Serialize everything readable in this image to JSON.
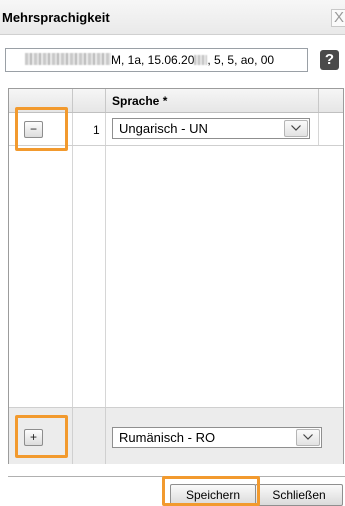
{
  "dialog": {
    "title": "Mehrsprachigkeit",
    "close_glyph": "X",
    "close_icon": "close-icon",
    "help_icon": "help-question-icon",
    "help_glyph": "?"
  },
  "context": {
    "prefix_blurred": "[redacted]",
    "text_a": "M, 1a, 15.06.20",
    "middle_blurred": "[redacted]",
    "text_b": ", 5, 5, ao, 00"
  },
  "grid": {
    "header": {
      "language_label": "Sprache *"
    },
    "rows": [
      {
        "number": "1",
        "remove_glyph": "−",
        "language": "Ungarisch - UN"
      }
    ],
    "new_row": {
      "add_glyph": "+",
      "language": "Rumänisch - RO"
    }
  },
  "actions": {
    "save_label": "Speichern",
    "close_label": "Schließen"
  },
  "colors": {
    "highlight": "#f29a2e",
    "help_button": "#4a4a4a"
  }
}
